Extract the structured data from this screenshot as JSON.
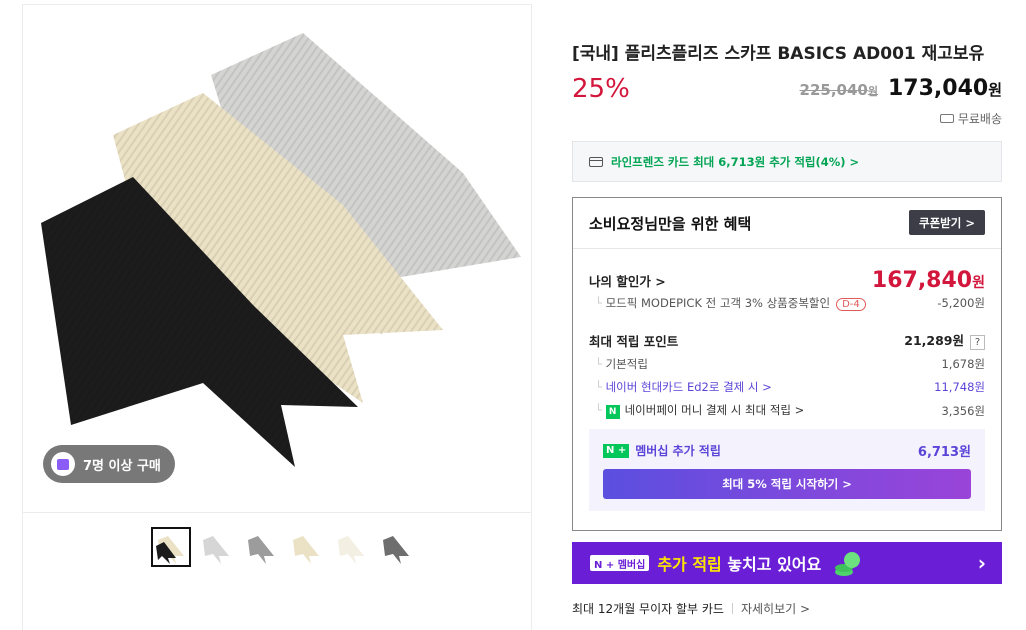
{
  "product": {
    "title": "[국내] 플리츠플리즈 스카프 BASICS AD001 재고보유",
    "discount": "25%",
    "original_price": "225,040",
    "price": "173,040",
    "currency": "원",
    "shipping": "무료배송",
    "buyers_badge": "7명 이상 구매"
  },
  "card_promo": "라인프렌즈 카드 최대 6,713원 추가 적립(4%) >",
  "benefit": {
    "heading": "소비요정님만을 위한 혜택",
    "coupon_label": "쿠폰받기 >",
    "my_price_label": "나의 할인가 >",
    "my_price": "167,840",
    "modepick_label": "모드픽 MODEPICK 전 고객 3% 상품중복할인",
    "modepick_tag": "D-4",
    "modepick_value": "-5,200원",
    "max_points_label": "최대 적립 포인트",
    "max_points": "21,289원",
    "help": "?",
    "basic_label": "기본적립",
    "basic_value": "1,678원",
    "naver_card_label": "네이버 현대카드 Ed2로 결제 시 >",
    "naver_card_value": "11,748원",
    "naverpay_label": "네이버페이 머니 결제 시 최대 적립 >",
    "naverpay_value": "3,356원",
    "npay_icon": "N",
    "nplus_badge": "N +",
    "membership_label": "멤버십 추가 적립",
    "membership_value": "6,713원",
    "start_btn": "최대 5% 적립 시작하기 >"
  },
  "banner": {
    "pill": "N + 멤버십",
    "text_1": "추가 적립",
    "text_2": " 놓치고 있어요",
    "arrow": "›"
  },
  "bottom": {
    "installment": "최대 12개월 무이자 할부 카드",
    "details": "자세히보기 >"
  },
  "colors": {
    "discount": "#d3163c",
    "naver_green": "#03c75a",
    "membership_purple": "#6a1fd6"
  },
  "thumbnails": [
    "black-beige-scarf",
    "light-gray-scarf",
    "gray-scarf",
    "beige-scarf",
    "ivory-scarf",
    "dark-gray-scarf"
  ]
}
